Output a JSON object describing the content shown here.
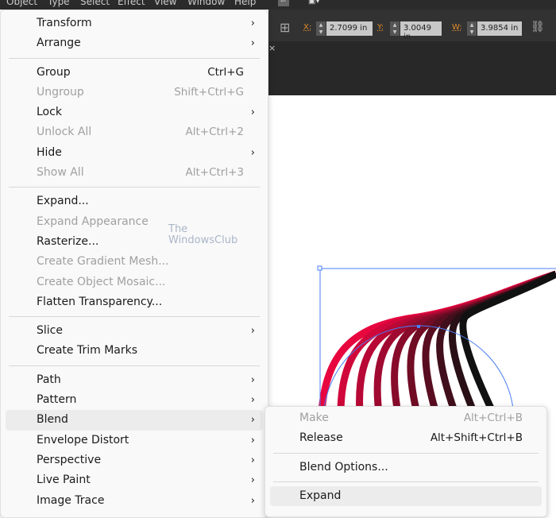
{
  "menubar": [
    "Object",
    "Type",
    "Select",
    "Effect",
    "View",
    "Window",
    "Help"
  ],
  "toolbar": {
    "x_label": "X:",
    "x_value": "2.7099 in",
    "y_label": "Y:",
    "y_value": "3.0049 in",
    "w_label": "W:",
    "w_value": "3.9854 in",
    "bridge": "Br"
  },
  "watermark": {
    "line1": "The",
    "line2": "WindowsClub"
  },
  "object_menu": [
    {
      "label": "Transform",
      "submenu": true
    },
    {
      "label": "Arrange",
      "submenu": true
    },
    {
      "sep": true
    },
    {
      "label": "Group",
      "shortcut": "Ctrl+G"
    },
    {
      "label": "Ungroup",
      "shortcut": "Shift+Ctrl+G",
      "disabled": true
    },
    {
      "label": "Lock",
      "submenu": true
    },
    {
      "label": "Unlock All",
      "shortcut": "Alt+Ctrl+2",
      "disabled": true
    },
    {
      "label": "Hide",
      "submenu": true
    },
    {
      "label": "Show All",
      "shortcut": "Alt+Ctrl+3",
      "disabled": true
    },
    {
      "sep": true
    },
    {
      "label": "Expand..."
    },
    {
      "label": "Expand Appearance",
      "disabled": true
    },
    {
      "label": "Rasterize..."
    },
    {
      "label": "Create Gradient Mesh...",
      "disabled": true
    },
    {
      "label": "Create Object Mosaic...",
      "disabled": true
    },
    {
      "label": "Flatten Transparency..."
    },
    {
      "sep": true
    },
    {
      "label": "Slice",
      "submenu": true
    },
    {
      "label": "Create Trim Marks"
    },
    {
      "sep": true
    },
    {
      "label": "Path",
      "submenu": true
    },
    {
      "label": "Pattern",
      "submenu": true
    },
    {
      "label": "Blend",
      "submenu": true,
      "highlighted": true
    },
    {
      "label": "Envelope Distort",
      "submenu": true
    },
    {
      "label": "Perspective",
      "submenu": true
    },
    {
      "label": "Live Paint",
      "submenu": true
    },
    {
      "label": "Image Trace",
      "submenu": true
    }
  ],
  "blend_submenu": [
    {
      "label": "Make",
      "shortcut": "Alt+Ctrl+B",
      "disabled": true
    },
    {
      "label": "Release",
      "shortcut": "Alt+Shift+Ctrl+B"
    },
    {
      "sep": true
    },
    {
      "label": "Blend Options..."
    },
    {
      "sep": true
    },
    {
      "label": "Expand",
      "highlighted": true
    }
  ],
  "colors": {
    "blend_start": "#e8063f",
    "blend_end": "#111111",
    "selection": "#4a7cf5"
  }
}
